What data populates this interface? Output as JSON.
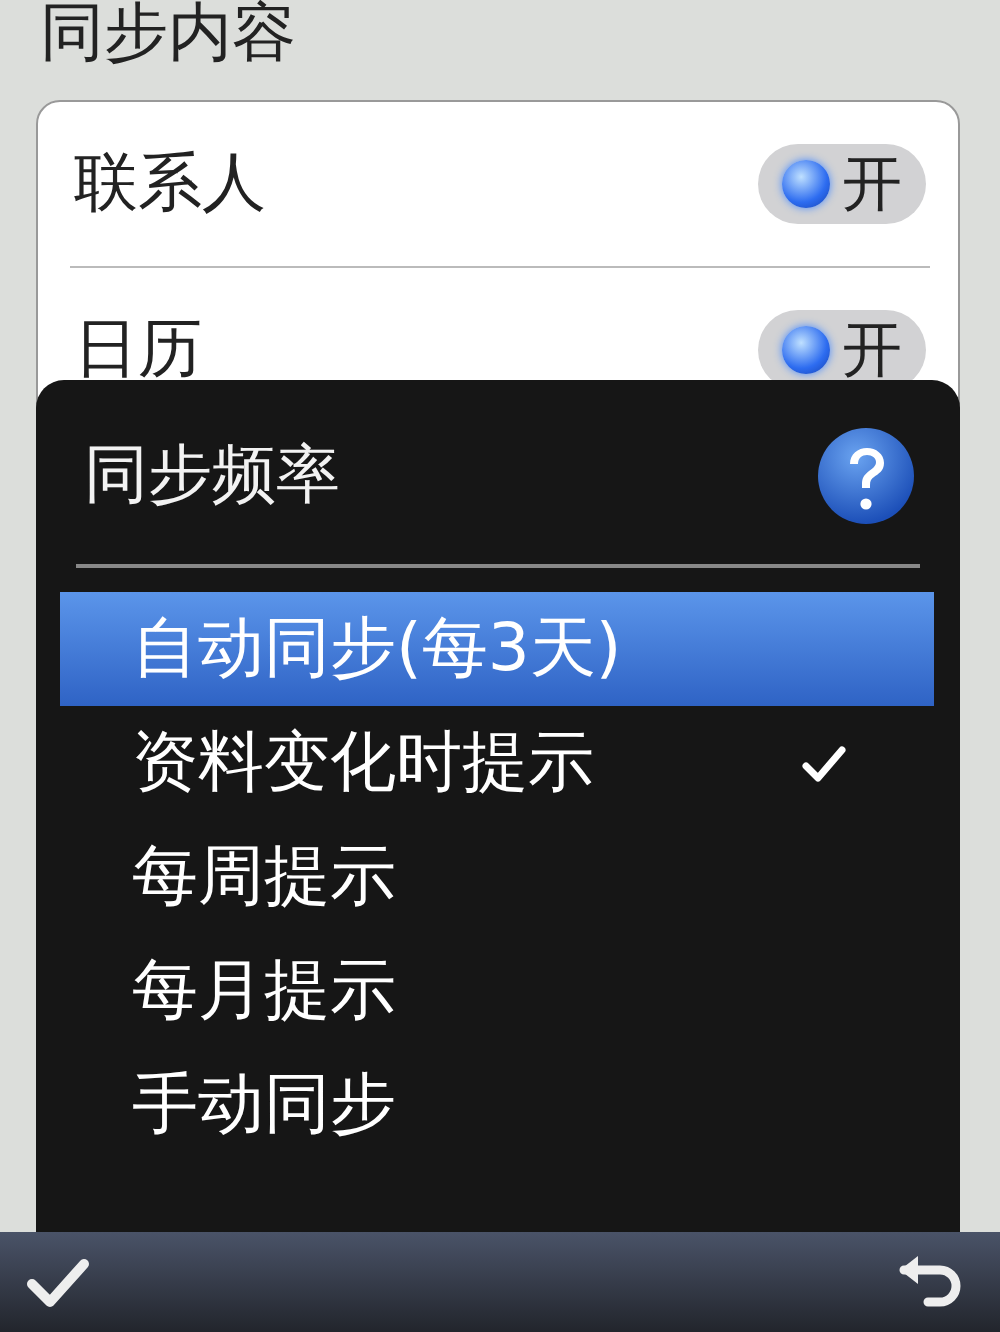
{
  "settings": {
    "section_title": "同步内容",
    "rows": [
      {
        "label": "联系人",
        "toggle": {
          "on": true,
          "text": "开"
        }
      },
      {
        "label": "日历",
        "toggle": {
          "on": true,
          "text": "开"
        }
      }
    ]
  },
  "dialog": {
    "title": "同步频率",
    "options": [
      {
        "label": "自动同步(每3天)",
        "selected": true,
        "checked": false
      },
      {
        "label": "资料变化时提示",
        "selected": false,
        "checked": true
      },
      {
        "label": "每周提示",
        "selected": false,
        "checked": false
      },
      {
        "label": "每月提示",
        "selected": false,
        "checked": false
      },
      {
        "label": "手动同步",
        "selected": false,
        "checked": false
      }
    ]
  }
}
